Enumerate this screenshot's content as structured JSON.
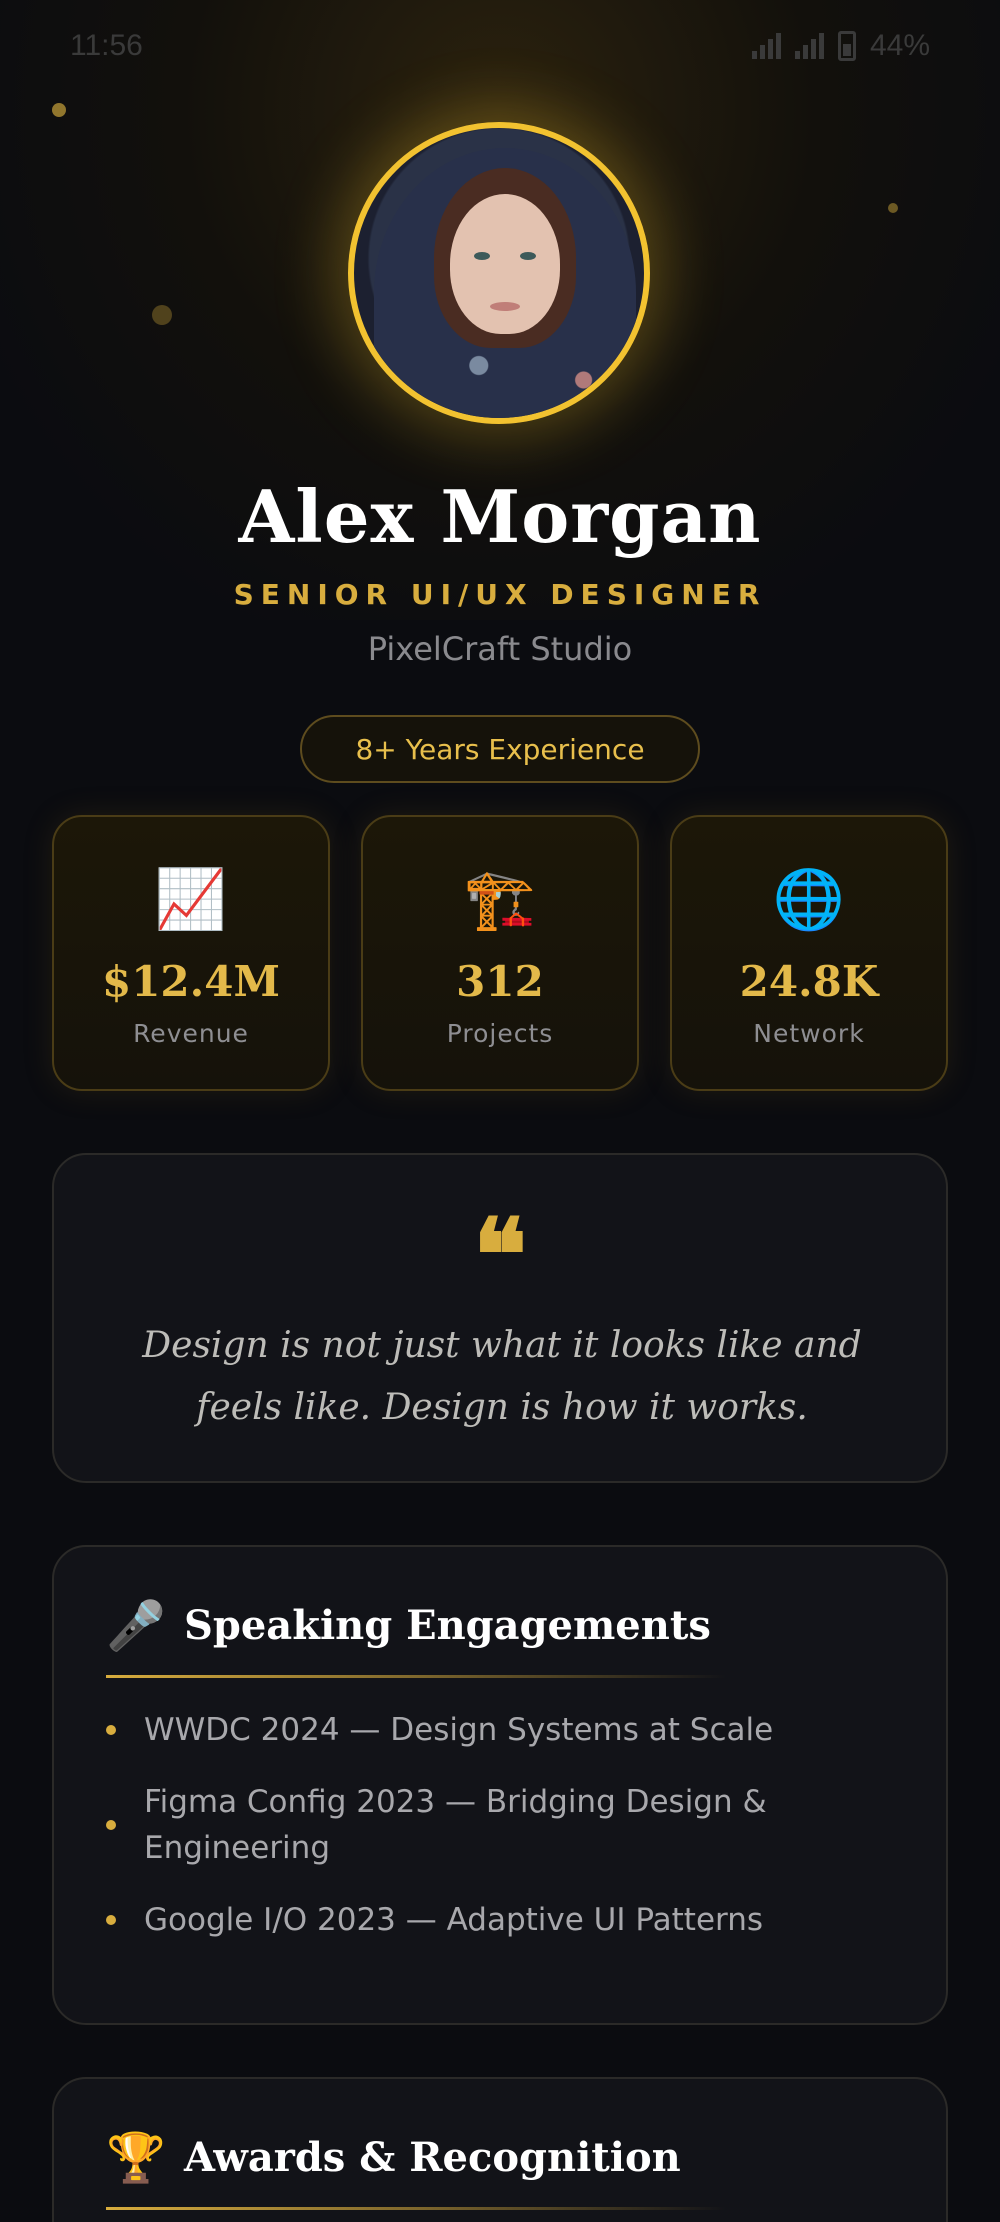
{
  "status_bar": {
    "time": "11:56",
    "battery": "44%"
  },
  "profile": {
    "name": "Alex Morgan",
    "role": "SENIOR UI/UX DESIGNER",
    "company": "PixelCraft Studio",
    "experience": "8+ Years Experience"
  },
  "stats": [
    {
      "icon": "📈",
      "icon_name": "chart-increasing-icon",
      "value": "$12.4M",
      "label": "Revenue"
    },
    {
      "icon": "🏗️",
      "icon_name": "construction-crane-icon",
      "value": "312",
      "label": "Projects"
    },
    {
      "icon": "🌐",
      "icon_name": "globe-icon",
      "value": "24.8K",
      "label": "Network"
    }
  ],
  "quote": {
    "mark": "❝",
    "text": "Design is not just what it looks like and feels like. Design is how it works."
  },
  "speaking": {
    "icon": "🎤",
    "title": "Speaking Engagements",
    "items": [
      "WWDC 2024 — Design Systems at Scale",
      "Figma Config 2023 — Bridging Design & Engineering",
      "Google I/O 2023 — Adaptive UI Patterns"
    ]
  },
  "awards": {
    "icon": "🏆",
    "title": "Awards & Recognition"
  },
  "colors": {
    "accent": "#d8ad3e",
    "background": "#0b0c10",
    "card": "#121318"
  }
}
